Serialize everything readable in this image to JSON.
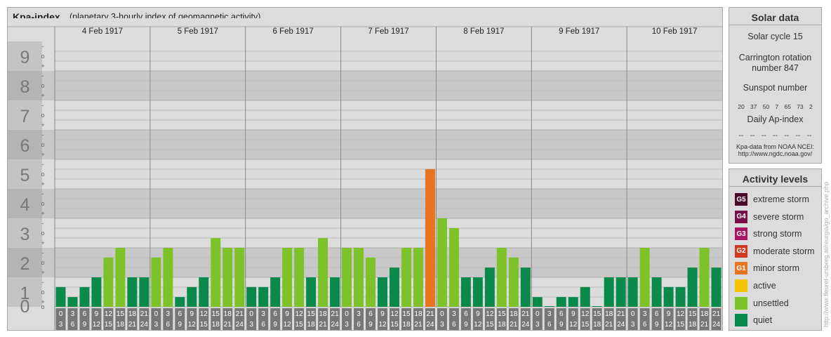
{
  "title": "Kpa-index",
  "subtitle": "(planetary 3-hourly index of geomagnetic activity)",
  "solar": {
    "title": "Solar data",
    "cycle": "Solar cycle 15",
    "carrington_line1": "Carrington rotation",
    "carrington_line2": "number 847",
    "sunspot_label": "Sunspot number",
    "sunspot_values": [
      "20",
      "37",
      "50",
      "7",
      "65",
      "73",
      "2"
    ],
    "ap_label": "Daily Ap-index",
    "ap_values": [
      "--",
      "--",
      "--",
      "--",
      "--",
      "--",
      "--"
    ],
    "source_line1": "Kpa-data from NOAA NCEI:",
    "source_line2": "http://www.ngdc.noaa.gov/"
  },
  "levels": {
    "title": "Activity levels",
    "items": [
      {
        "badge": "G5",
        "label": "extreme storm",
        "color": "#4a0a28"
      },
      {
        "badge": "G4",
        "label": "severe storm",
        "color": "#7a1048"
      },
      {
        "badge": "G3",
        "label": "strong storm",
        "color": "#a8155e"
      },
      {
        "badge": "G2",
        "label": "moderate storm",
        "color": "#d23a20"
      },
      {
        "badge": "G1",
        "label": "minor storm",
        "color": "#e87320"
      },
      {
        "badge": "",
        "label": "active",
        "color": "#f4c400"
      },
      {
        "badge": "",
        "label": "unsettled",
        "color": "#7cc228"
      },
      {
        "badge": "",
        "label": "quiet",
        "color": "#0a8a4a"
      }
    ]
  },
  "url_text": "http://www.fleuret-ursberg.at/reurgia/go_archive.php",
  "chart_data": {
    "type": "bar",
    "ylim": [
      0,
      9
    ],
    "yticks": [
      "0",
      "1",
      "2",
      "3",
      "4",
      "5",
      "6",
      "7",
      "8",
      "9"
    ],
    "subticks": [
      "-",
      "o",
      "+"
    ],
    "days": [
      "4 Feb 1917",
      "5 Feb 1917",
      "6 Feb 1917",
      "7 Feb 1917",
      "8 Feb 1917",
      "9 Feb 1917",
      "10 Feb 1917"
    ],
    "interval_labels": [
      [
        "0",
        "3"
      ],
      [
        "3",
        "6"
      ],
      [
        "6",
        "9"
      ],
      [
        "9",
        "12"
      ],
      [
        "12",
        "15"
      ],
      [
        "15",
        "18"
      ],
      [
        "18",
        "21"
      ],
      [
        "21",
        "24"
      ]
    ],
    "values": [
      [
        0.67,
        0.33,
        0.67,
        1.0,
        1.67,
        2.0,
        1.0,
        1.0
      ],
      [
        1.67,
        2.0,
        0.33,
        0.67,
        1.0,
        2.33,
        2.0,
        2.0
      ],
      [
        0.67,
        0.67,
        1.0,
        2.0,
        2.0,
        1.0,
        2.33,
        1.0
      ],
      [
        2.0,
        2.0,
        1.67,
        1.0,
        1.33,
        2.0,
        2.0,
        4.67
      ],
      [
        3.0,
        2.67,
        1.0,
        1.0,
        1.33,
        2.0,
        1.67,
        1.33
      ],
      [
        0.33,
        0.0,
        0.33,
        0.33,
        0.67,
        0.0,
        1.0,
        1.0
      ],
      [
        1.0,
        2.0,
        1.0,
        0.67,
        0.67,
        1.33,
        2.0,
        1.33
      ]
    ],
    "colors": {
      "quiet": "#0a8a4a",
      "unsettled": "#7cc228",
      "active": "#f4c400",
      "G1": "#e87320"
    },
    "band_colors": [
      "#c8c8c8",
      "#dcdcdc"
    ]
  }
}
